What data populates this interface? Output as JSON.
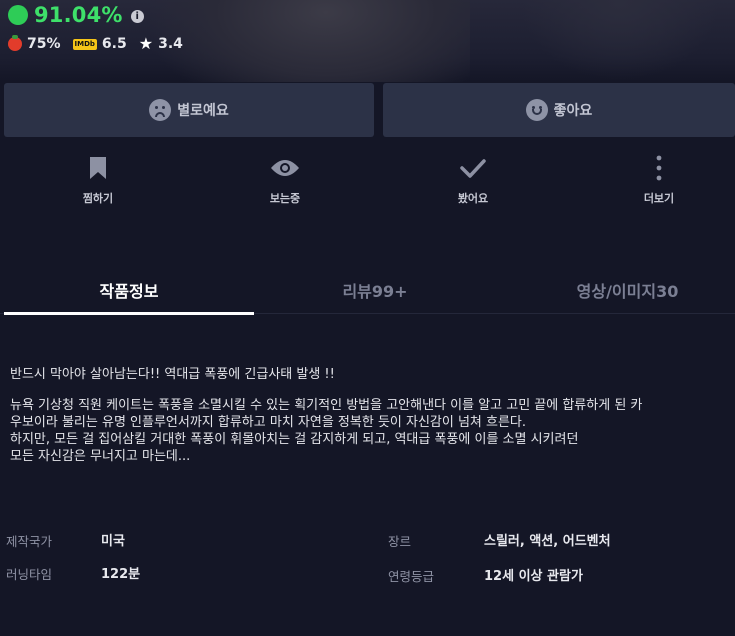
{
  "hero": {
    "score": "91.04%",
    "ratings": {
      "tomato": "75%",
      "imdb_badge": "IMDb",
      "imdb": "6.5",
      "star": "3.4"
    }
  },
  "reactions": {
    "dislike_label": "별로예요",
    "like_label": "좋아요"
  },
  "actions": {
    "wishlist": "찜하기",
    "watching": "보는중",
    "watched": "봤어요",
    "more": "더보기"
  },
  "tabs": {
    "info": "작품정보",
    "reviews": "리뷰99+",
    "media": "영상/이미지30"
  },
  "synopsis": {
    "tagline": "반드시 막아야 살아남는다!!  역대급 폭풍에 긴급사태 발생 !!",
    "line1": "뉴욕 기상청 직원 케이트는 폭풍을 소멸시킬 수 있는 획기적인 방법을 고안해낸다 이를 알고 고민 끝에 합류하게 된 카",
    "line2": "우보이라 불리는 유명 인플루언서까지 합류하고 마치 자연을 정복한 듯이 자신감이 넘쳐 흐른다.",
    "line3": "하지만, 모든 걸 집어삼킬 거대한 폭풍이 휘몰아치는 걸 감지하게 되고, 역대급 폭풍에 이를 소멸 시키려던",
    "line4": "모든 자신감은 무너지고 마는데..."
  },
  "meta": {
    "country_label": "제작국가",
    "country": "미국",
    "runtime_label": "러닝타임",
    "runtime": "122분",
    "genre_label": "장르",
    "genre": "스릴러, 액션, 어드벤처",
    "rating_label": "연령등급",
    "rating": "12세 이상 관람가"
  },
  "colors": {
    "background": "#141626",
    "score_green": "#3ee06a",
    "button_bg": "#2c3247",
    "tab_inactive": "#7b7f93"
  }
}
